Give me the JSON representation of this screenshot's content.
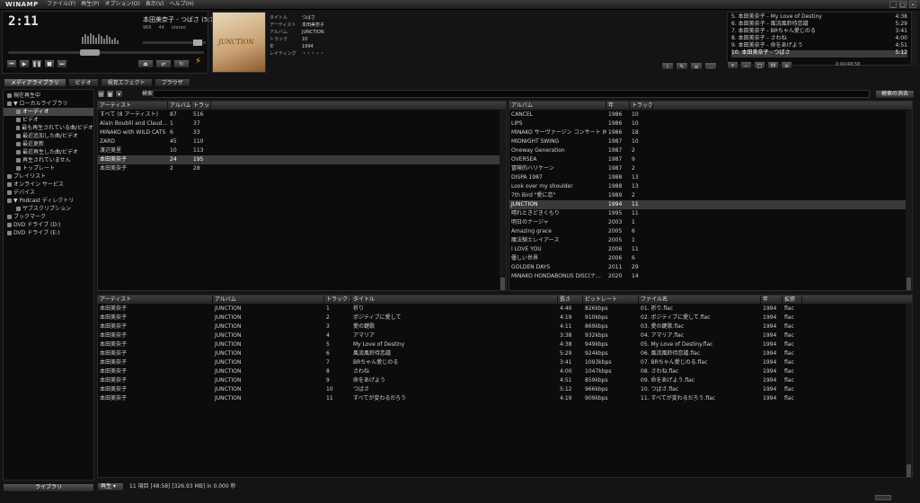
{
  "titlebar": {
    "logo": "WINAMP",
    "menu": [
      "ファイル(F)",
      "再生(P)",
      "オプション(O)",
      "表示(V)",
      "ヘルプ(H)"
    ]
  },
  "player": {
    "time": "2:11",
    "song": "本田美奈子 - つばさ (5:12)",
    "kbps": "966",
    "khz": "44",
    "mode": "stereo",
    "icons": [
      "prev-icon",
      "play-icon",
      "pause-icon",
      "stop-icon",
      "next-icon",
      "eject-icon",
      "bolt-icon"
    ],
    "seek_fraction": 0.41
  },
  "album_art": {
    "label": "JUNCTION"
  },
  "info": {
    "rows": [
      {
        "label": "タイトル",
        "value": "つばさ"
      },
      {
        "label": "アーティスト",
        "value": "本田美奈子"
      },
      {
        "label": "アルバム",
        "value": "JUNCTION"
      },
      {
        "label": "トラック",
        "value": "10"
      },
      {
        "label": "年",
        "value": "1994"
      },
      {
        "label": "レイティング",
        "value": "・・・・・"
      }
    ]
  },
  "playlist": {
    "items": [
      {
        "title": "5. 本田美奈子 - My Love of Destiny",
        "len": "4:38",
        "active": false
      },
      {
        "title": "6. 本田美奈子 - 風流風鈴待恋譜",
        "len": "5:29",
        "active": false
      },
      {
        "title": "7. 本田美奈子 - BRちゃん愛じのる",
        "len": "3:41",
        "active": false
      },
      {
        "title": "8. 本田美奈子 - さわね",
        "len": "4:00",
        "active": false
      },
      {
        "title": "9. 本田美奈子 - 命をあげよう",
        "len": "4:51",
        "active": false
      },
      {
        "title": "10. 本田美奈子 - つばさ",
        "len": "5:12",
        "active": true
      }
    ],
    "time": "0:00/48:58"
  },
  "tabs": [
    {
      "label": "メディアライブラリ",
      "active": true
    },
    {
      "label": "ビデオ",
      "active": false
    },
    {
      "label": "視覚エフェクト",
      "active": false
    },
    {
      "label": "ブラウザ",
      "active": false
    }
  ],
  "tree": [
    {
      "label": "現在再生中",
      "indent": 0,
      "sel": false
    },
    {
      "label": "▼ ローカルライブラリ",
      "indent": 0,
      "sel": false
    },
    {
      "label": "オーディオ",
      "indent": 1,
      "sel": true
    },
    {
      "label": "ビデオ",
      "indent": 1,
      "sel": false
    },
    {
      "label": "最も再生されている曲/ビデオ",
      "indent": 1,
      "sel": false
    },
    {
      "label": "最近追加した曲/ビデオ",
      "indent": 1,
      "sel": false
    },
    {
      "label": "最近更新",
      "indent": 1,
      "sel": false
    },
    {
      "label": "最近再生した曲/ビデオ",
      "indent": 1,
      "sel": false
    },
    {
      "label": "再生されていません",
      "indent": 1,
      "sel": false
    },
    {
      "label": "トップレート",
      "indent": 1,
      "sel": false
    },
    {
      "label": "プレイリスト",
      "indent": 0,
      "sel": false
    },
    {
      "label": "オンライン サービス",
      "indent": 0,
      "sel": false
    },
    {
      "label": "デバイス",
      "indent": 0,
      "sel": false
    },
    {
      "label": "▼ Podcast ディレクトリ",
      "indent": 0,
      "sel": false
    },
    {
      "label": "サブスクリプション",
      "indent": 1,
      "sel": false
    },
    {
      "label": "ブックマーク",
      "indent": 0,
      "sel": false
    },
    {
      "label": "DVD ドライブ (D:)",
      "indent": 0,
      "sel": false
    },
    {
      "label": "DVD ドライブ (E:)",
      "indent": 0,
      "sel": false
    }
  ],
  "library_button": "ライブラリ",
  "search": {
    "label": "検索:",
    "value": "",
    "clear_button": "検索の消去"
  },
  "artist_pane": {
    "headers": [
      "アーティスト",
      "アルバム",
      "トラック"
    ],
    "rows": [
      [
        "すべて (8 アーティスト)",
        "87",
        "516"
      ],
      [
        "Alain Boublil and Claud...",
        "1",
        "37"
      ],
      [
        "MINAKO with WILD CATS",
        "6",
        "33"
      ],
      [
        "ZARD",
        "45",
        "110"
      ],
      [
        "渡辺美里",
        "10",
        "113"
      ],
      [
        "本田美奈子",
        "24",
        "195"
      ],
      [
        "本田美奈子",
        "2",
        "28"
      ]
    ],
    "selected": 5
  },
  "album_pane": {
    "headers": [
      "アルバム",
      "年",
      "トラック"
    ],
    "rows": [
      [
        "CANCEL",
        "1986",
        "10"
      ],
      [
        "LIPS",
        "1986",
        "10"
      ],
      [
        "MINAKO サーヴァージン コンサート IN ...",
        "1986",
        "18"
      ],
      [
        "MIDNIGHT SWING",
        "1987",
        "10"
      ],
      [
        "Oneway Generation",
        "1987",
        "2"
      ],
      [
        "OVERSEA",
        "1987",
        "9"
      ],
      [
        "冒険的ハリケーン",
        "1987",
        "2"
      ],
      [
        "DISPA 1987",
        "1988",
        "13"
      ],
      [
        "Look over my shoulder",
        "1988",
        "13"
      ],
      [
        "7th Bird \"愛に恋\"",
        "1989",
        "2"
      ],
      [
        "JUNCTION",
        "1994",
        "11"
      ],
      [
        "晴れときどきくもり",
        "1995",
        "11"
      ],
      [
        "明日のナージャ",
        "2003",
        "1"
      ],
      [
        "Amazing grace",
        "2005",
        "6"
      ],
      [
        "魔法騎士レイアース",
        "2005",
        "1"
      ],
      [
        "I LOVE YOU",
        "2006",
        "11"
      ],
      [
        "優しい世界",
        "2006",
        "6"
      ],
      [
        "GOLDEN DAYS",
        "2011",
        "29"
      ],
      [
        "MINAKO HONDABONUS DISC(ナ...",
        "2020",
        "14"
      ]
    ],
    "selected": 10
  },
  "track_pane": {
    "headers": [
      "アーティスト",
      "アルバム",
      "トラック #",
      "タイトル",
      "長さ",
      "ビットレート",
      "ファイル名",
      "年",
      "拡張"
    ],
    "rows": [
      [
        "本田美奈子",
        "JUNCTION",
        "1",
        "祈り",
        "4:40",
        "826kbps",
        "01. 祈り.flac",
        "1994",
        "flac"
      ],
      [
        "本田美奈子",
        "JUNCTION",
        "2",
        "ポジティブに愛して",
        "4:19",
        "910kbps",
        "02. ポジティブに愛して.flac",
        "1994",
        "flac"
      ],
      [
        "本田美奈子",
        "JUNCTION",
        "3",
        "愛の鍵歌",
        "4:11",
        "869kbps",
        "03. 愛の鍵歌.flac",
        "1994",
        "flac"
      ],
      [
        "本田美奈子",
        "JUNCTION",
        "4",
        "アマリア",
        "3:38",
        "932kbps",
        "04. アマリア.flac",
        "1994",
        "flac"
      ],
      [
        "本田美奈子",
        "JUNCTION",
        "5",
        "My Love of Destiny",
        "4:38",
        "949kbps",
        "05. My Love of Destiny.flac",
        "1994",
        "flac"
      ],
      [
        "本田美奈子",
        "JUNCTION",
        "6",
        "風流風鈴待恋譜",
        "5:29",
        "924kbps",
        "06. 風流風鈴待恋譜.flac",
        "1994",
        "flac"
      ],
      [
        "本田美奈子",
        "JUNCTION",
        "7",
        "BRちゃん愛じのる",
        "3:41",
        "1093kbps",
        "07. BRちゃん愛じのる.flac",
        "1994",
        "flac"
      ],
      [
        "本田美奈子",
        "JUNCTION",
        "8",
        "さわね",
        "4:00",
        "1047kbps",
        "08. さわね.flac",
        "1994",
        "flac"
      ],
      [
        "本田美奈子",
        "JUNCTION",
        "9",
        "命をあげよう",
        "4:51",
        "859kbps",
        "09. 命をあげよう.flac",
        "1994",
        "flac"
      ],
      [
        "本田美奈子",
        "JUNCTION",
        "10",
        "つばさ",
        "5:12",
        "966kbps",
        "10. つばさ.flac",
        "1994",
        "flac"
      ],
      [
        "本田美奈子",
        "JUNCTION",
        "11",
        "すべてが変わるだろう",
        "4:19",
        "909kbps",
        "11. すべてが変わるだろう.flac",
        "1994",
        "flac"
      ]
    ]
  },
  "statusbar": {
    "play_button": "再生 ▾",
    "text": "11 項目 [48:58] [326.93 MB] in 0.000 秒"
  }
}
